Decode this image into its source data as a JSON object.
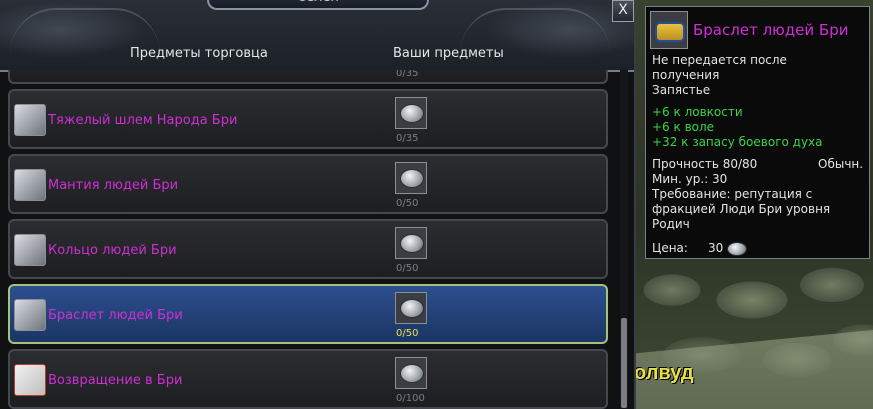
{
  "window": {
    "title": "Селен",
    "close_label": "X",
    "col_vendor": "Предметы торговца",
    "col_yours": "Ваши предметы"
  },
  "top_partial_row": {
    "qty": "0/35"
  },
  "items": [
    {
      "name": "Тяжелый шлем Народа Бри",
      "icon": "helmet-icon",
      "qty": "0/35"
    },
    {
      "name": "Мантия людей Бри",
      "icon": "robe-icon",
      "qty": "0/50"
    },
    {
      "name": "Кольцо людей Бри",
      "icon": "ring-icon",
      "qty": "0/50"
    },
    {
      "name": "Браслет людей Бри",
      "icon": "bracelet-icon",
      "qty": "0/50",
      "selected": true
    },
    {
      "name": "Возвращение в Бри",
      "icon": "scroll-icon",
      "qty": "0/100"
    }
  ],
  "tooltip": {
    "title": "Браслет людей Бри",
    "bind_line1": "Не передается после",
    "bind_line2": "получения",
    "slot": "Запястье",
    "stat1": "+6 к ловкости",
    "stat2": "+6 к воле",
    "stat3": "+32 к запасу боевого духа",
    "durability": "Прочность 80/80",
    "quality": "Обычн.",
    "min_level": "Мин. ур.: 30",
    "req_line1": "Требование: репутация с",
    "req_line2": "фракцией Люди Бри уровня",
    "req_line3": "Родич",
    "price_label": "Цена:",
    "price_value": "30"
  },
  "world": {
    "location_text": "олвуд"
  },
  "colors": {
    "item_name": "#cf2fd3",
    "stat_green": "#39d446",
    "selected_row": "#2d4f8f",
    "selected_qty": "#e8e04c"
  }
}
